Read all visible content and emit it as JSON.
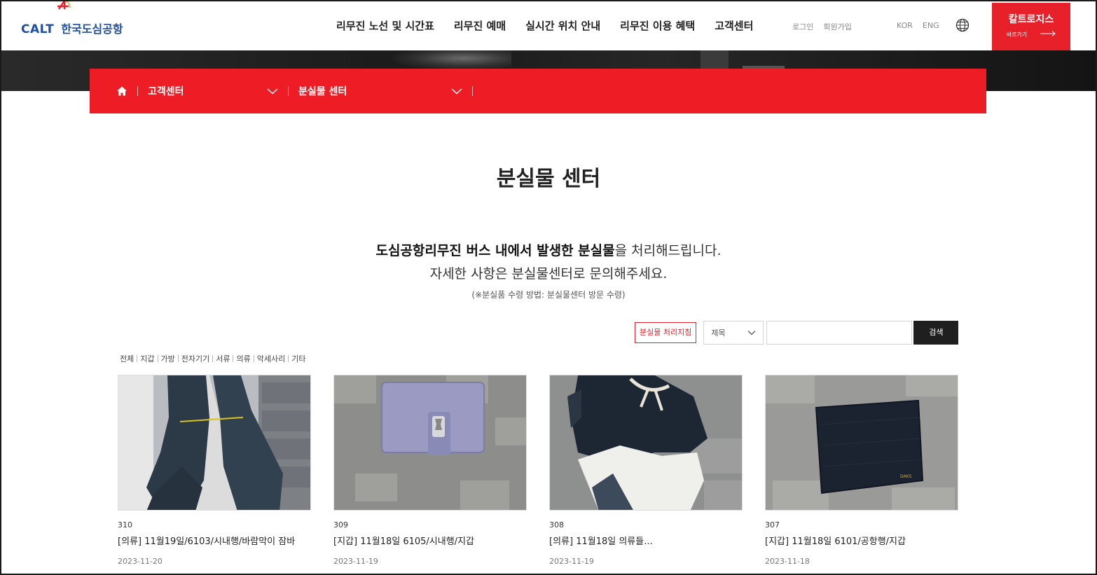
{
  "header": {
    "logo_en": "CALT",
    "logo_kr": "한국도심공항",
    "nav": [
      "리무진 노선 및 시간표",
      "리무진 예매",
      "실시간 위치 안내",
      "리무진 이용 혜택",
      "고객센터"
    ],
    "login": "로그인",
    "signup": "회원가입",
    "lang_kor": "KOR",
    "lang_eng": "ENG",
    "cta_title": "칼트로지스",
    "cta_sub": "바로가기"
  },
  "location": {
    "level1": "고객센터",
    "level2": "분실물 센터"
  },
  "page": {
    "title": "분실물 센터",
    "intro_bold": "도심공항리무진 버스 내에서 발생한 분실물",
    "intro_rest": "을 처리해드립니다.",
    "intro_line2": "자세한 사항은 분실물센터로 문의해주세요.",
    "note": "(※분실품 수령 방법: 분실물센터 방문 수령)"
  },
  "search": {
    "guide_button": "분실물 처리지침",
    "select_value": "제목",
    "input_value": "",
    "button": "검색"
  },
  "categories": [
    "전체",
    "지갑",
    "가방",
    "전자기기",
    "서류",
    "의류",
    "악세사리",
    "기타"
  ],
  "items": [
    {
      "no": "310",
      "title": "[의류] 11월19일/6103/시내행/바람막이 잠바",
      "date": "2023-11-20"
    },
    {
      "no": "309",
      "title": "[지갑] 11월18일 6105/시내행/지갑",
      "date": "2023-11-19"
    },
    {
      "no": "308",
      "title": "[의류] 11월18일 의류들...",
      "date": "2023-11-19"
    },
    {
      "no": "307",
      "title": "[지갑] 11월18일 6101/공항행/지갑",
      "date": "2023-11-18"
    }
  ],
  "colors": {
    "brand_red": "#ee1c25",
    "brand_blue": "#1e4fa5",
    "dark_button": "#1f1f1f"
  },
  "icons": [
    "home-icon",
    "chevron-down-icon",
    "globe-icon",
    "arrow-right-icon"
  ]
}
